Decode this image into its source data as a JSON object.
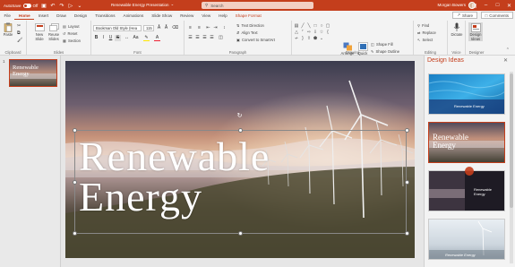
{
  "titlebar": {
    "autosave_label": "AutoSave",
    "autosave_state": "Off",
    "doc_title": "Renewable Energy Presentation",
    "search_placeholder": "Search",
    "user_name": "Morgan Bowers",
    "accent": "#c43e1c"
  },
  "tabs": [
    "File",
    "Home",
    "Insert",
    "Draw",
    "Design",
    "Transitions",
    "Animations",
    "Slide Show",
    "Review",
    "View",
    "Help",
    "Shape Format"
  ],
  "tabs_active": "Home",
  "share_label": "Share",
  "comments_label": "Comments",
  "ribbon": {
    "clipboard": {
      "paste": "Paste",
      "label": "Clipboard"
    },
    "slides": {
      "new_slide": "New Slide",
      "reuse_slides": "Reuse Slides",
      "layout": "Layout",
      "reset": "Reset",
      "section": "Section",
      "label": "Slides"
    },
    "font": {
      "font_name": "Bookman Old Style (Hea",
      "font_size": "115",
      "bold": "B",
      "italic": "I",
      "underline": "U",
      "strike": "S",
      "label": "Font"
    },
    "paragraph": {
      "text_direction": "Text Direction",
      "align_text": "Align Text",
      "smartart": "Convert to SmartArt",
      "label": "Paragraph"
    },
    "drawing": {
      "arrange": "Arrange",
      "quick_styles": "Quick Styles",
      "shape_fill": "Shape Fill",
      "shape_outline": "Shape Outline",
      "shape_effects": "Shape Effects",
      "label": "Drawing"
    },
    "editing": {
      "find": "Find",
      "replace": "Replace",
      "select": "Select",
      "label": "Editing"
    },
    "voice": {
      "dictate": "Dictate",
      "label": "Voice"
    },
    "designer": {
      "design_ideas": "Design Ideas",
      "label": "Designer"
    }
  },
  "thumbnails": {
    "slide_number": "1",
    "thumb_text_1": "Renewable",
    "thumb_text_2": "Energy"
  },
  "slide": {
    "title_line1": "Renewable",
    "title_line2": "Energy"
  },
  "design_pane": {
    "title": "Design Ideas",
    "ideas": [
      {
        "text": "Renewable Energy"
      },
      {
        "text_1": "Renewable",
        "text_2": "Energy"
      },
      {
        "text_1": "Renewable",
        "text_2": "Energy"
      },
      {
        "text": "Renewable Energy"
      }
    ]
  }
}
